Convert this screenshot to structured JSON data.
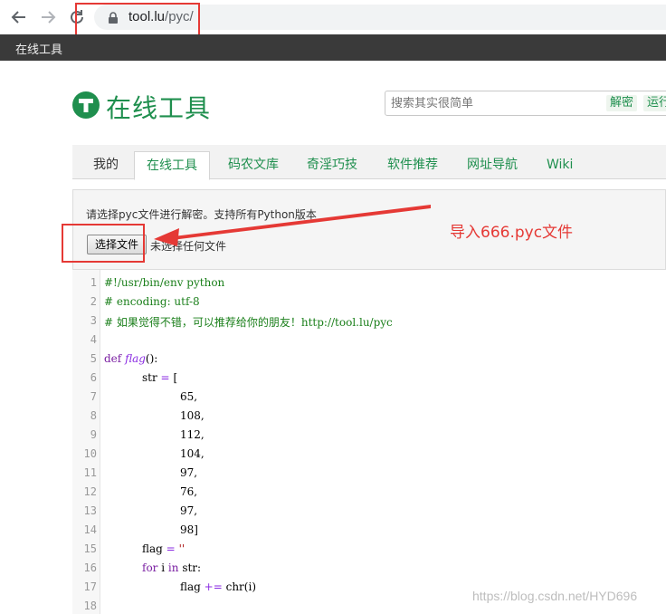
{
  "browser": {
    "back_icon": "arrow-left-icon",
    "forward_icon": "arrow-right-icon",
    "reload_icon": "reload-icon",
    "url_host": "tool.lu",
    "url_path": "/pyc/"
  },
  "bookmarks": {
    "label": "在线工具"
  },
  "header": {
    "title": "在线工具",
    "search_placeholder": "搜索其实很简单",
    "decrypt_label": "解密",
    "run_label": "运行"
  },
  "tabs": [
    {
      "label": "我的"
    },
    {
      "label": "在线工具"
    },
    {
      "label": "码农文库"
    },
    {
      "label": "奇淫巧技"
    },
    {
      "label": "软件推荐"
    },
    {
      "label": "网址导航"
    },
    {
      "label": "Wiki"
    }
  ],
  "upload": {
    "description": "请选择pyc文件进行解密。支持所有Python版本",
    "choose_button": "选择文件",
    "no_file": "未选择任何文件"
  },
  "annotation": {
    "text": "导入666.pyc文件",
    "color": "#e53935"
  },
  "code": {
    "line_numbers": [
      "1",
      "2",
      "3",
      "4",
      "5",
      "6",
      "7",
      "8",
      "9",
      "10",
      "11",
      "12",
      "13",
      "14",
      "15",
      "16",
      "17",
      "18"
    ],
    "l1": "#!/usr/bin/env python",
    "l2": "# encoding: utf-8",
    "l3": "# 如果觉得不错，可以推荐给你的朋友！http://tool.lu/pyc",
    "l5_kw": "def",
    "l5_name": "flag",
    "l5_rest": "():",
    "l6_var": "str",
    "l6_op": "=",
    "l6_rest": "[",
    "l7": "65,",
    "l8": "108,",
    "l9": "112,",
    "l10": "104,",
    "l11": "97,",
    "l12": "76,",
    "l13": "97,",
    "l14": "98]",
    "l15_var": "flag",
    "l15_op": "=",
    "l15_str": "''",
    "l16_for": "for",
    "l16_i": "i",
    "l16_in": "in",
    "l16_rest": "str:",
    "l17_var": "flag",
    "l17_op": "+=",
    "l17_rest": "chr(i)"
  },
  "watermark": "https://blog.csdn.net/HYD696",
  "colors": {
    "brand_green": "#1f8f4e",
    "highlight_red": "#e53935"
  }
}
